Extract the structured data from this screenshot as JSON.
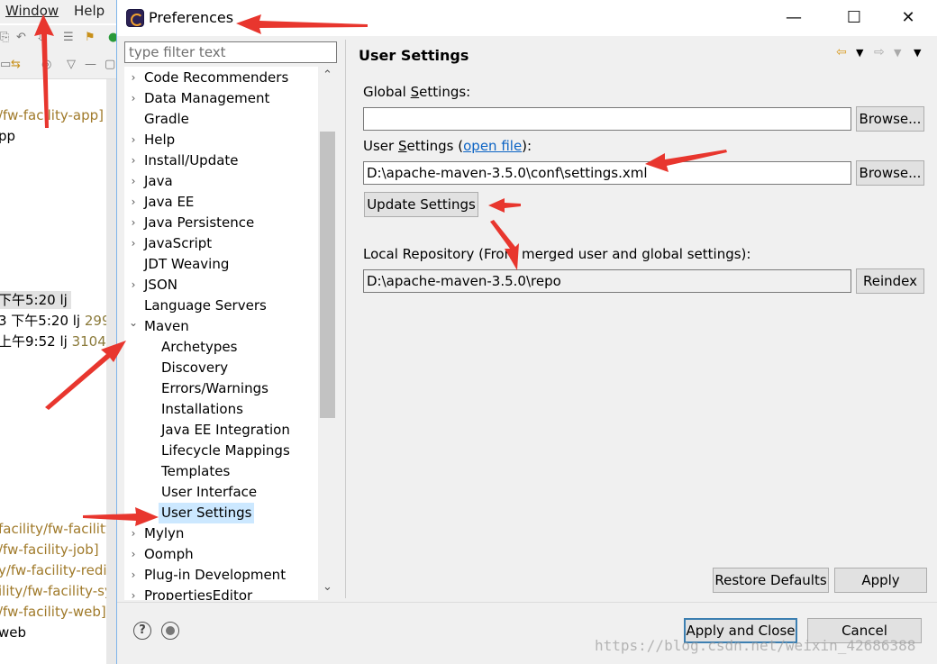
{
  "background_window": {
    "menu": [
      "Window",
      "Help"
    ],
    "lines": [
      {
        "text": "/fw-facility-app]",
        "style": "dim"
      },
      {
        "text": "pp",
        "style": "plain"
      },
      {
        "text": "下午5:20  lj",
        "style": "hl"
      },
      {
        "pre": "3 下午5:20  lj ",
        "post": "299"
      },
      {
        "pre": " 上午9:52  lj ",
        "post": "3104"
      },
      {
        "text": "facility/fw-facility-",
        "style": "dim"
      },
      {
        "text": "/fw-facility-job]",
        "style": "dim"
      },
      {
        "text": "y/fw-facility-redi",
        "style": "dim"
      },
      {
        "text": "ility/fw-facility-sy",
        "style": "dim"
      },
      {
        "text": "/fw-facility-web]",
        "style": "dim"
      },
      {
        "text": "web",
        "style": "plain"
      }
    ]
  },
  "dialog": {
    "title": "Preferences",
    "window_controls": {
      "minimize": "—",
      "maximize": "☐",
      "close": "✕"
    }
  },
  "filter": {
    "placeholder": "type filter text"
  },
  "tree": {
    "items": [
      {
        "label": "Code Recommenders",
        "level": 0,
        "expander": "collapsed"
      },
      {
        "label": "Data Management",
        "level": 0,
        "expander": "collapsed"
      },
      {
        "label": "Gradle",
        "level": 0,
        "expander": "none"
      },
      {
        "label": "Help",
        "level": 0,
        "expander": "collapsed"
      },
      {
        "label": "Install/Update",
        "level": 0,
        "expander": "collapsed"
      },
      {
        "label": "Java",
        "level": 0,
        "expander": "collapsed"
      },
      {
        "label": "Java EE",
        "level": 0,
        "expander": "collapsed"
      },
      {
        "label": "Java Persistence",
        "level": 0,
        "expander": "collapsed"
      },
      {
        "label": "JavaScript",
        "level": 0,
        "expander": "collapsed"
      },
      {
        "label": "JDT Weaving",
        "level": 0,
        "expander": "none"
      },
      {
        "label": "JSON",
        "level": 0,
        "expander": "collapsed"
      },
      {
        "label": "Language Servers",
        "level": 0,
        "expander": "none"
      },
      {
        "label": "Maven",
        "level": 0,
        "expander": "expanded"
      },
      {
        "label": "Archetypes",
        "level": 1,
        "expander": "none"
      },
      {
        "label": "Discovery",
        "level": 1,
        "expander": "none"
      },
      {
        "label": "Errors/Warnings",
        "level": 1,
        "expander": "none"
      },
      {
        "label": "Installations",
        "level": 1,
        "expander": "none"
      },
      {
        "label": "Java EE Integration",
        "level": 1,
        "expander": "none"
      },
      {
        "label": "Lifecycle Mappings",
        "level": 1,
        "expander": "none"
      },
      {
        "label": "Templates",
        "level": 1,
        "expander": "none"
      },
      {
        "label": "User Interface",
        "level": 1,
        "expander": "none"
      },
      {
        "label": "User Settings",
        "level": 1,
        "expander": "none",
        "selected": true
      },
      {
        "label": "Mylyn",
        "level": 0,
        "expander": "collapsed"
      },
      {
        "label": "Oomph",
        "level": 0,
        "expander": "collapsed"
      },
      {
        "label": "Plug-in Development",
        "level": 0,
        "expander": "collapsed"
      },
      {
        "label": "PropertiesEditor",
        "level": 0,
        "expander": "collapsed"
      }
    ]
  },
  "page": {
    "title": "User Settings",
    "global_settings": {
      "label_pre": "Global ",
      "label_mnemonic": "S",
      "label_post": "ettings:",
      "value": "",
      "browse_label": "Browse..."
    },
    "user_settings": {
      "label_pre": "User ",
      "label_mnemonic": "S",
      "label_post": "ettings (",
      "link": "open file",
      "label_end": "):",
      "value": "D:\\apache-maven-3.5.0\\conf\\settings.xml",
      "browse_label": "Browse..."
    },
    "update_label": "Update Settings",
    "local_repository": {
      "label": "Local Repository (From merged user and global settings):",
      "value": "D:\\apache-maven-3.5.0\\repo",
      "reindex_label": "Reindex"
    },
    "restore_defaults_label": "Restore Defaults",
    "apply_label": "Apply"
  },
  "footer": {
    "help_icon": "?",
    "apply_close_label": "Apply and Close",
    "cancel_label": "Cancel"
  },
  "watermark": "https://blog.csdn.net/weixin_42686388",
  "colors": {
    "selection": "#cce8ff",
    "link": "#0b63c4",
    "annotation_arrow": "#e8362e",
    "default_button_border": "#3c7fb1"
  }
}
